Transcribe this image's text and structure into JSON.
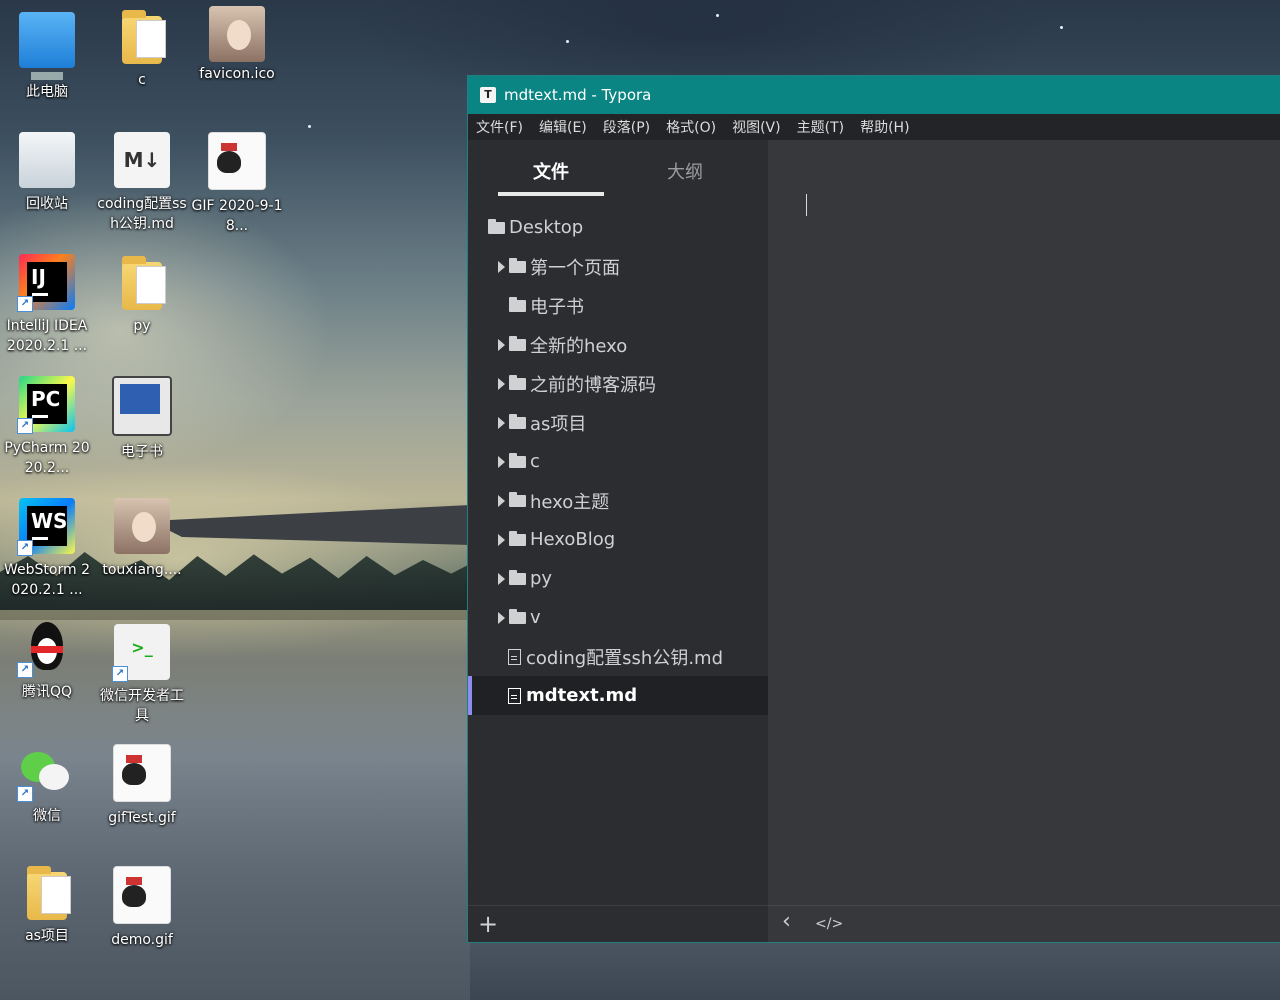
{
  "desktop": {
    "icons": [
      {
        "label": "此电脑"
      },
      {
        "label": "c"
      },
      {
        "label": "favicon.ico"
      },
      {
        "label": "回收站"
      },
      {
        "label": "coding配置ssh公钥.md"
      },
      {
        "label": "GIF 2020-9-18..."
      },
      {
        "label": "IntelliJ IDEA 2020.2.1 ..."
      },
      {
        "label": "py"
      },
      {
        "label": "PyCharm 2020.2..."
      },
      {
        "label": "电子书"
      },
      {
        "label": "WebStorm 2020.2.1 ..."
      },
      {
        "label": "touxiang...."
      },
      {
        "label": "腾讯QQ"
      },
      {
        "label": "微信开发者工具"
      },
      {
        "label": "微信"
      },
      {
        "label": "gifTest.gif"
      },
      {
        "label": "as项目"
      },
      {
        "label": "demo.gif"
      }
    ],
    "icon_glyphs": {
      "md": "M↓",
      "ij": "IJ",
      "pc": "PC",
      "ws": "WS",
      "wxdev": ">_",
      "shortcut": "↗"
    }
  },
  "window": {
    "title": "mdtext.md - Typora",
    "app_icon": "T",
    "menu": [
      "文件(F)",
      "编辑(E)",
      "段落(P)",
      "格式(O)",
      "视图(V)",
      "主题(T)",
      "帮助(H)"
    ],
    "tabs": {
      "files": "文件",
      "outline": "大纲"
    },
    "tree": {
      "root": "Desktop",
      "items": [
        {
          "label": "第一个页面",
          "type": "folder",
          "expandable": true
        },
        {
          "label": "电子书",
          "type": "folder",
          "expandable": false
        },
        {
          "label": "全新的hexo",
          "type": "folder",
          "expandable": true
        },
        {
          "label": "之前的博客源码",
          "type": "folder",
          "expandable": true
        },
        {
          "label": "as项目",
          "type": "folder",
          "expandable": true
        },
        {
          "label": "c",
          "type": "folder",
          "expandable": true
        },
        {
          "label": "hexo主题",
          "type": "folder",
          "expandable": true
        },
        {
          "label": "HexoBlog",
          "type": "folder",
          "expandable": true
        },
        {
          "label": "py",
          "type": "folder",
          "expandable": true
        },
        {
          "label": "v",
          "type": "folder",
          "expandable": true
        },
        {
          "label": "coding配置ssh公钥.md",
          "type": "file",
          "expandable": false
        },
        {
          "label": "mdtext.md",
          "type": "file",
          "expandable": false,
          "selected": true
        }
      ]
    },
    "footer": {
      "add": "+",
      "back": "‹",
      "source": "</>"
    }
  },
  "colors": {
    "titlebar": "#0b8583",
    "sidebar": "#2b2d30",
    "editor": "#36383c",
    "selection_accent": "#8e8cf0"
  }
}
